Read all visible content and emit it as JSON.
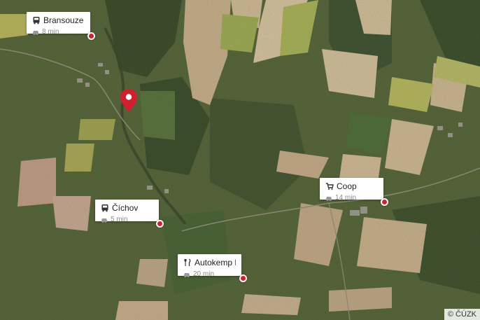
{
  "map": {
    "pin_color": "#d0202e",
    "attribution": "© ČÚZK"
  },
  "pois": [
    {
      "name": "Bransouze",
      "icon": "bus-icon",
      "time": "8 min",
      "mode": "car-icon"
    },
    {
      "name": "Číchov",
      "icon": "bus-icon",
      "time": "5 min",
      "mode": "car-icon"
    },
    {
      "name": "Coop",
      "icon": "cart-icon",
      "time": "14 min",
      "mode": "car-icon"
    },
    {
      "name": "Autokemp Kratoc...",
      "icon": "fork-knife-icon",
      "time": "20 min",
      "mode": "car-icon"
    }
  ]
}
